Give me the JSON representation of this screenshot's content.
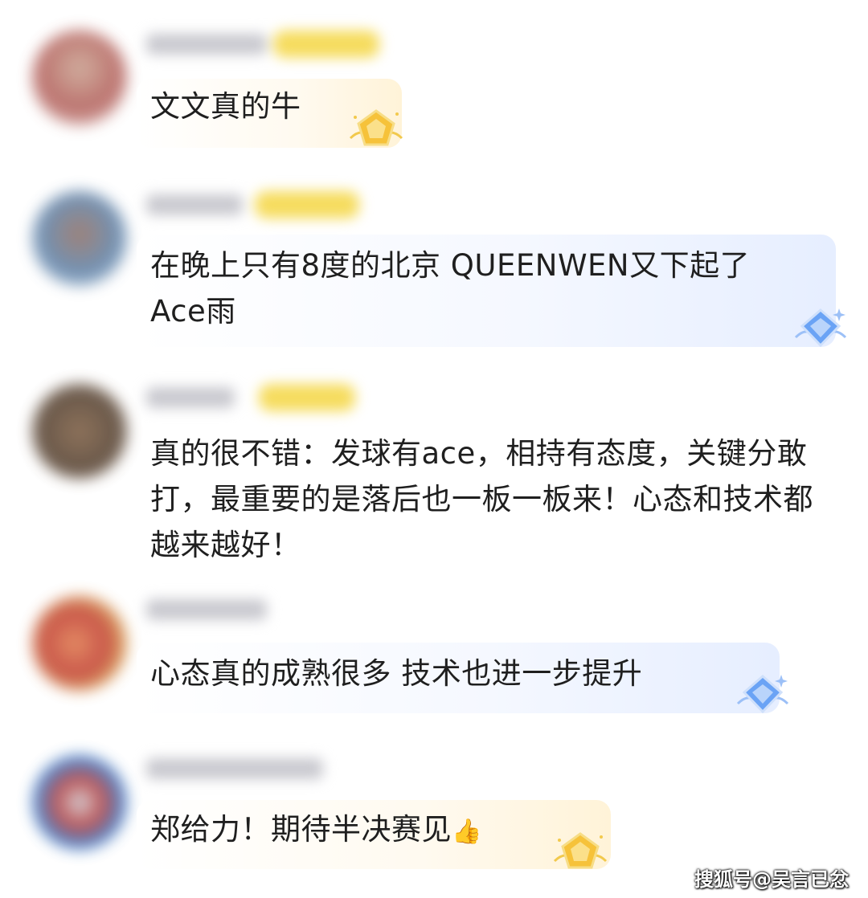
{
  "comments": [
    {
      "text": "文文真的牛",
      "badge": "gold-pentagon-badge-icon"
    },
    {
      "text": "在晚上只有8度的北京 QUEENWEN又下起了Ace雨",
      "badge": "blue-diamond-badge-icon"
    },
    {
      "text": "真的很不错：发球有ace，相持有态度，关键分敢打，最重要的是落后也一板一板来！心态和技术都越来越好！",
      "badge": ""
    },
    {
      "text": "心态真的成熟很多 技术也进一步提升",
      "badge": "blue-diamond-badge-icon"
    },
    {
      "text": "郑给力！期待半决赛见",
      "emoji": "👍",
      "badge": "gold-pentagon-badge-icon"
    }
  ],
  "watermark": "搜狐号@吴言已忿",
  "colors": {
    "gold": "#f6c23a",
    "blue": "#6aa3f5",
    "blur_tag": "#f6dc5e"
  }
}
